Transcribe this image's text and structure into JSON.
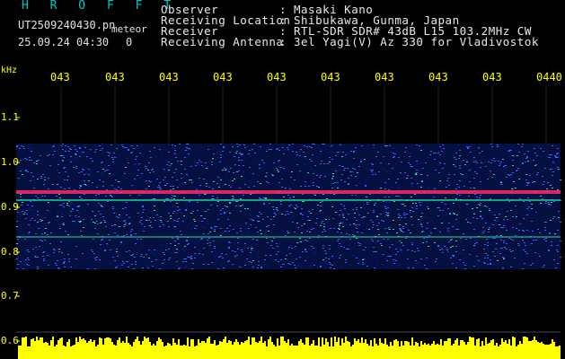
{
  "header": {
    "program": "H R O F F T",
    "filename": "UT2509240430.pn",
    "filetype": "meteor",
    "datetime": "25.09.24 04:30",
    "count": "0"
  },
  "info": [
    {
      "key": "Observer",
      "value": "Masaki Kano"
    },
    {
      "key": "Receiving Location",
      "value": "Shibukawa, Gunma, Japan"
    },
    {
      "key": "Receiver",
      "value": "RTL-SDR SDR# 43dB L15 103.2MHz CW"
    },
    {
      "key": "Receiving Antenna",
      "value": "3el Yagi(V) Az 330 for Vladivostok"
    }
  ],
  "separator": ":",
  "time_axis": [
    "043",
    "043",
    "043",
    "043",
    "043",
    "043",
    "043",
    "043",
    "043",
    "0440"
  ],
  "freq_axis": {
    "unit": "kHz",
    "labels": [
      "1.1",
      "1.0",
      "0.9",
      "0.8",
      "0.7",
      "0.6"
    ]
  },
  "colors": {
    "background": "#000000",
    "axis_text": "#ffff00",
    "title": "#00c8c8",
    "signal_band": "#ff2a6a",
    "noise_low": "#0a1a8a",
    "noise_mid": "#2a6aff",
    "noise_high": "#20e0a0",
    "power_bar": "#ffff00"
  }
}
